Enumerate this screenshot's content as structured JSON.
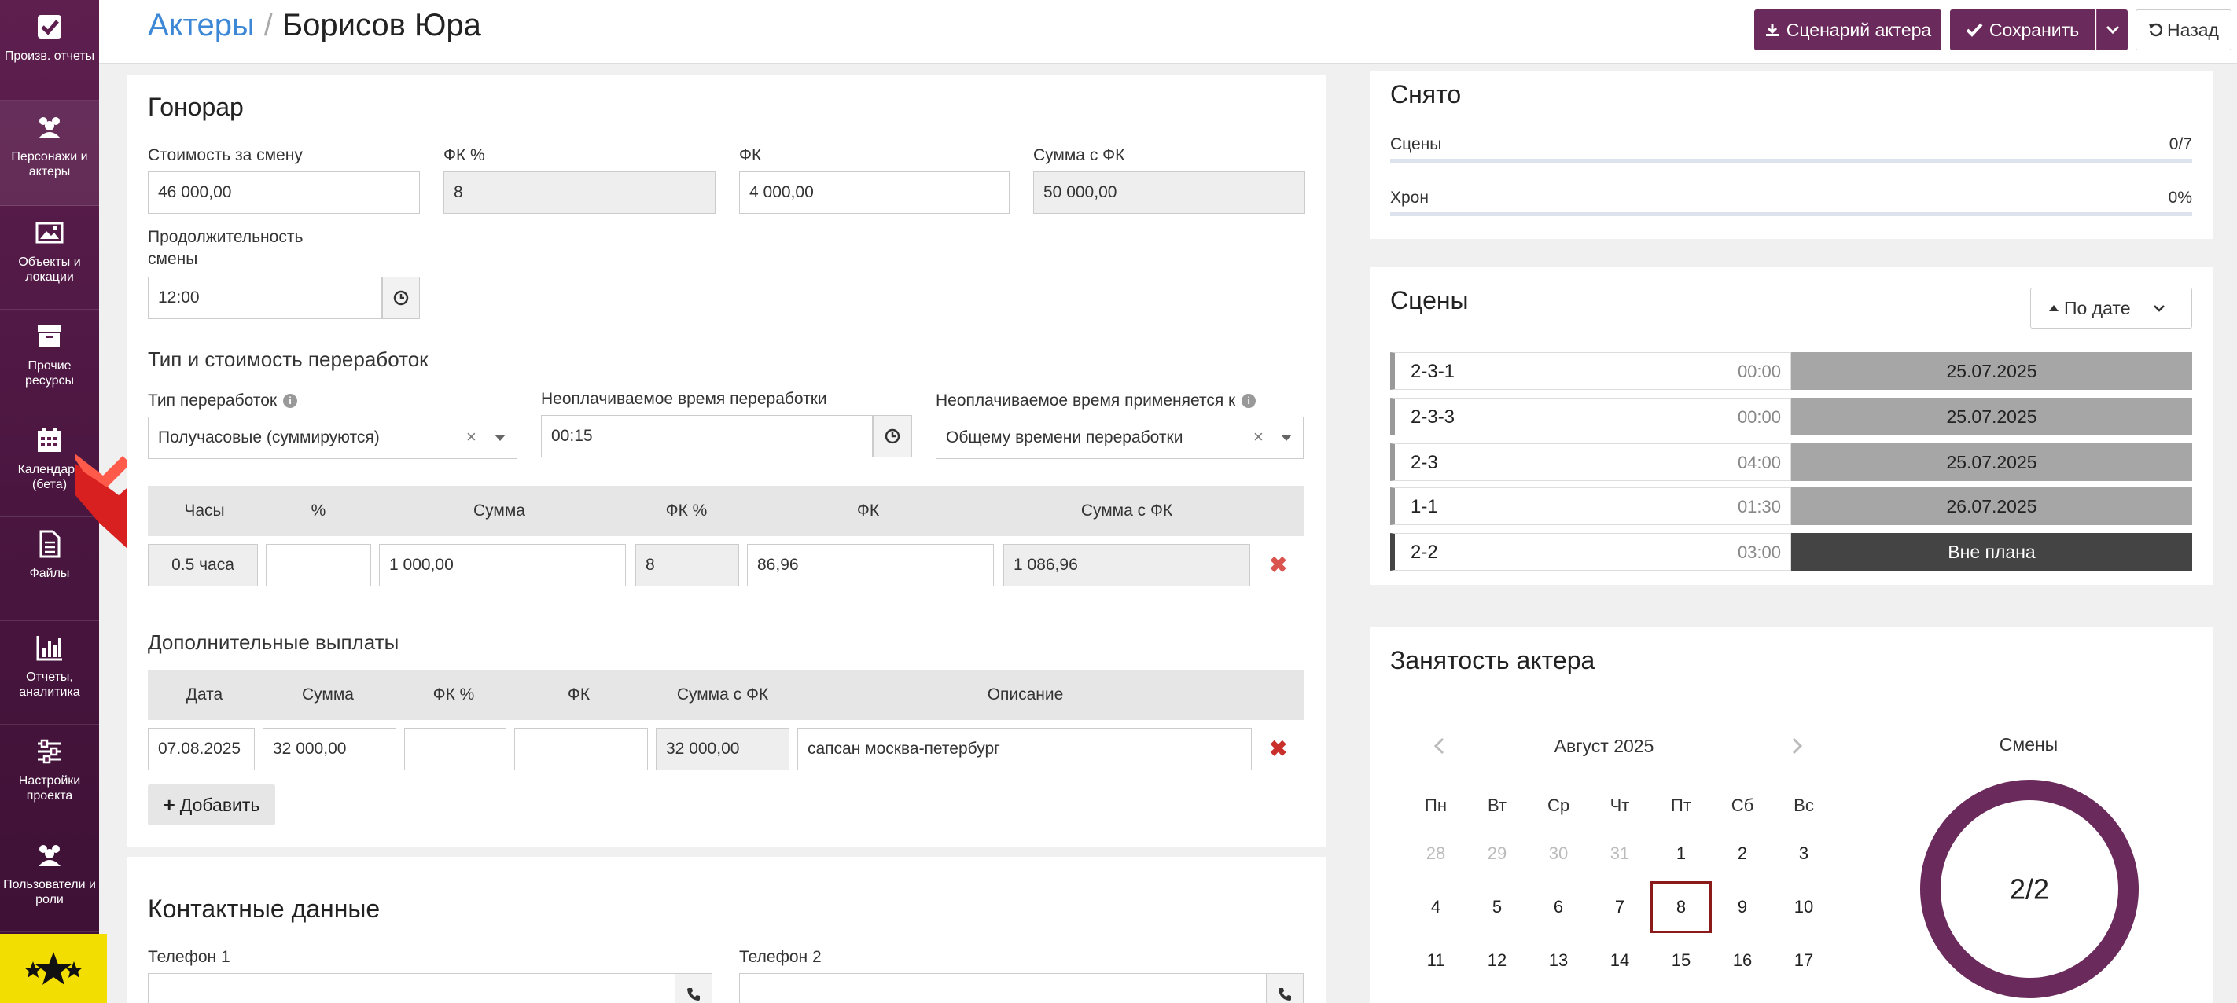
{
  "sidebar": {
    "items": [
      {
        "label": "Произв. отчеты",
        "icon": "checkbox-icon"
      },
      {
        "label": "Персонажи и актеры",
        "icon": "users-icon"
      },
      {
        "label": "Объекты и локации",
        "icon": "image-icon"
      },
      {
        "label": "Прочие ресурсы",
        "icon": "archive-icon"
      },
      {
        "label": "Календарь (бета)",
        "icon": "calendar-icon"
      },
      {
        "label": "Файлы",
        "icon": "file-icon"
      },
      {
        "label": "Отчеты, аналитика",
        "icon": "bar-chart-icon"
      },
      {
        "label": "Настройки проекта",
        "icon": "sliders-icon"
      },
      {
        "label": "Пользователи и роли",
        "icon": "users-icon"
      }
    ]
  },
  "header": {
    "crumb_link": "Актеры",
    "separator": "/",
    "title": "Борисов Юра",
    "script_button": "Сценарий актера",
    "save_button": "Сохранить",
    "back_button": "Назад"
  },
  "fee": {
    "title": "Гонорар",
    "shift_cost_label": "Стоимость за смену",
    "shift_cost_value": "46 000,00",
    "fk_pct_label": "ФК %",
    "fk_pct_value": "8",
    "fk_label": "ФК",
    "fk_value": "4 000,00",
    "sum_fk_label": "Сумма с ФК",
    "sum_fk_value": "50 000,00",
    "duration_label_1": "Продолжительность",
    "duration_label_2": "смены",
    "duration_value": "12:00"
  },
  "overtime": {
    "title": "Тип и стоимость переработок",
    "type_label": "Тип переработок",
    "type_value": "Получасовые (суммируются)",
    "unpaid_label": "Неоплачиваемое время переработки",
    "unpaid_value": "00:15",
    "applies_label": "Неоплачиваемое время применяется к",
    "applies_value": "Общему времени переработки",
    "table_headers": [
      "Часы",
      "%",
      "Сумма",
      "ФК %",
      "ФК",
      "Сумма с ФК"
    ],
    "row": {
      "hours": "0.5 часа",
      "pct": "",
      "sum": "1 000,00",
      "fk_pct": "8",
      "fk": "86,96",
      "sum_fk": "1 086,96"
    }
  },
  "extra": {
    "title": "Дополнительные выплаты",
    "table_headers": [
      "Дата",
      "Сумма",
      "ФК %",
      "ФК",
      "Сумма с ФК",
      "Описание"
    ],
    "row": {
      "date": "07.08.2025",
      "sum": "32 000,00",
      "fk_pct": "",
      "fk": "",
      "sum_fk": "32 000,00",
      "desc": "сапсан москва-петербург"
    },
    "add_button": "Добавить"
  },
  "contacts": {
    "title": "Контактные данные",
    "phone1_label": "Телефон 1",
    "phone2_label": "Телефон 2"
  },
  "filmed": {
    "title": "Снято",
    "scenes_label": "Сцены",
    "scenes_value": "0/7",
    "scenes_fraction": 0,
    "chron_label": "Хрон",
    "chron_value": "0%",
    "chron_fraction": 0
  },
  "scenes": {
    "title": "Сцены",
    "sort_label": "По дате",
    "rows": [
      {
        "code": "2-3-1",
        "time": "00:00",
        "date": "25.07.2025",
        "dark": false
      },
      {
        "code": "2-3-3",
        "time": "00:00",
        "date": "25.07.2025",
        "dark": false
      },
      {
        "code": "2-3",
        "time": "04:00",
        "date": "25.07.2025",
        "dark": false
      },
      {
        "code": "1-1",
        "time": "01:30",
        "date": "26.07.2025",
        "dark": false
      },
      {
        "code": "2-2",
        "time": "03:00",
        "date": "Вне плана",
        "dark": true
      }
    ]
  },
  "employment": {
    "title": "Занятость актера",
    "month": "Август 2025",
    "weekdays": [
      "Пн",
      "Вт",
      "Ср",
      "Чт",
      "Пт",
      "Сб",
      "Вс"
    ],
    "weeks": [
      [
        "28",
        "29",
        "30",
        "31",
        "1",
        "2",
        "3"
      ],
      [
        "4",
        "5",
        "6",
        "7",
        "8",
        "9",
        "10"
      ],
      [
        "11",
        "12",
        "13",
        "14",
        "15",
        "16",
        "17"
      ]
    ],
    "muted": [
      "28",
      "29",
      "30",
      "31"
    ],
    "today": "8",
    "shifts_label": "Смены",
    "shifts_value": "2/2",
    "shifts_fraction": 1
  },
  "colors": {
    "accent": "#6b2a5c",
    "link": "#3c87d6",
    "ring": "#6b2a5c",
    "banner": "#f2de00"
  }
}
